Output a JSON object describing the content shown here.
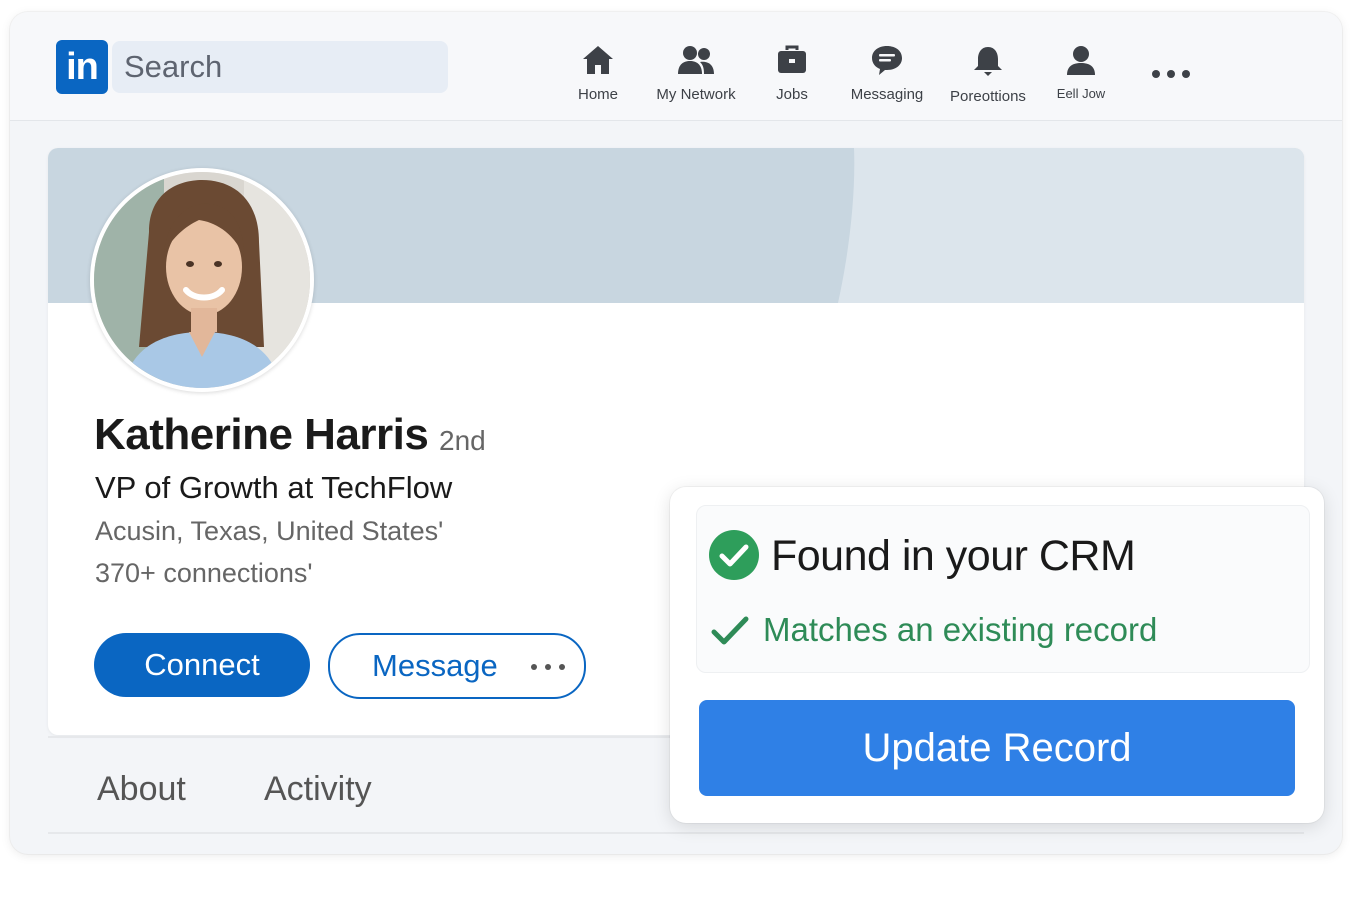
{
  "nav": {
    "logo_text": "in",
    "search_placeholder": "Search",
    "items": [
      {
        "label": "Home",
        "icon": "home-icon"
      },
      {
        "label": "My Network",
        "icon": "network-icon"
      },
      {
        "label": "Jobs",
        "icon": "briefcase-icon"
      },
      {
        "label": "Messaging",
        "icon": "chat-icon"
      },
      {
        "label": "Poreottions",
        "icon": "bell-icon"
      },
      {
        "label": "Eell Jow",
        "icon": "person-icon"
      }
    ],
    "more_icon": "more-horizontal-icon"
  },
  "profile": {
    "name": "Katherine Harris",
    "degree": "2nd",
    "headline": "VP of Growth at TechFlow",
    "location": "Acusin, Texas, United States'",
    "connections": "370+ connections'",
    "connect_label": "Connect",
    "message_label": "Message"
  },
  "tabs": [
    "About",
    "Activity"
  ],
  "crm": {
    "title": "Found in your CRM",
    "subtitle": "Matches an existing record",
    "button_label": "Update Record",
    "success_color": "#2e9e5b",
    "button_color": "#2f80e6"
  },
  "colors": {
    "brand": "#0a66c2",
    "banner": "#c8d6e0"
  }
}
